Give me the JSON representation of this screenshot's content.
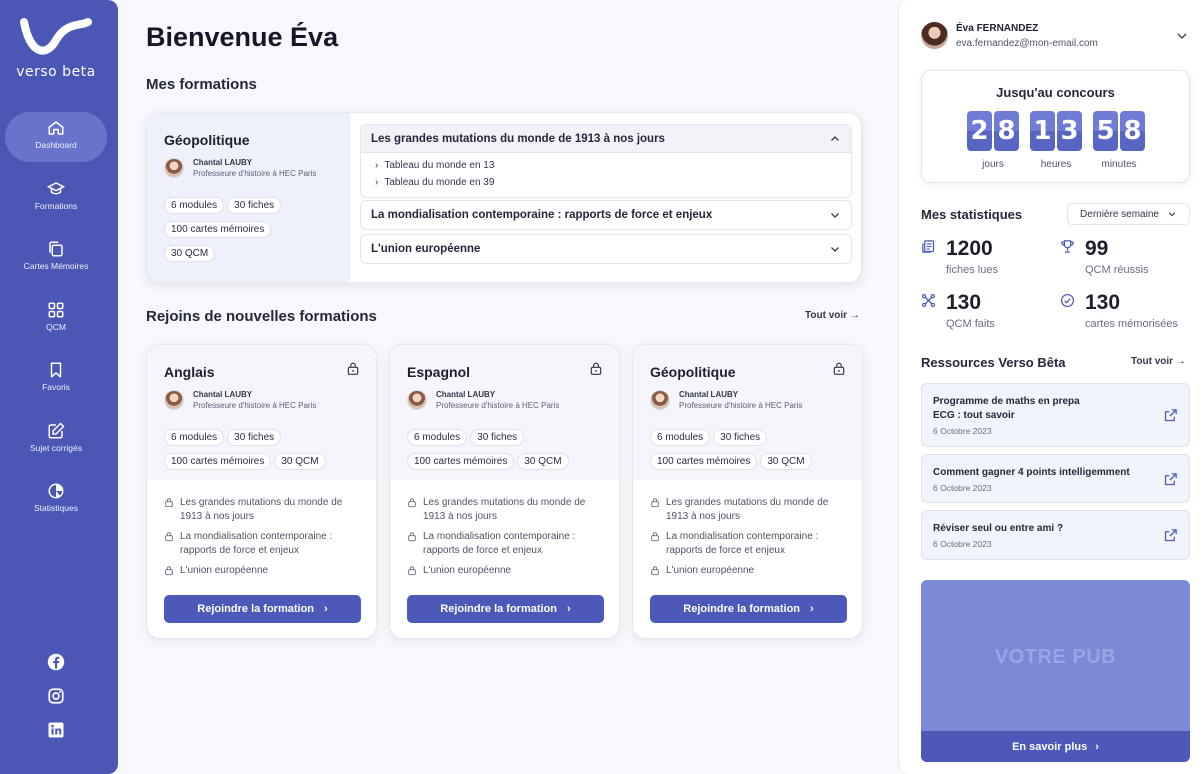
{
  "brand": {
    "logo_text": "verso beta"
  },
  "nav": {
    "items": [
      {
        "label": "Dashboard",
        "icon": "home-icon",
        "active": true
      },
      {
        "label": "Formations",
        "icon": "graduation-cap-icon"
      },
      {
        "label": "Cartes Mémoires",
        "icon": "cards-icon"
      },
      {
        "label": "QCM",
        "icon": "grid-icon"
      },
      {
        "label": "Favoris",
        "icon": "bookmark-icon"
      },
      {
        "label": "Sujet corrigés",
        "icon": "edit-icon"
      },
      {
        "label": "Statistiques",
        "icon": "pie-chart-icon"
      }
    ],
    "social": [
      "facebook-icon",
      "instagram-icon",
      "linkedin-icon"
    ]
  },
  "main": {
    "welcome": "Bienvenue Éva",
    "my_formations_title": "Mes formations",
    "current": {
      "title": "Géopolitique",
      "teacher_name": "Chantal LAUBY",
      "teacher_role": "Professeure d'histoire à HEC Paris",
      "pills": [
        "6 modules",
        "30 fiches",
        "100 cartes mémoires",
        "30 QCM"
      ],
      "modules": [
        {
          "title": "Les grandes mutations du monde de 1913 à nos jours",
          "open": true,
          "items": [
            "Tableau du monde en 13",
            "Tableau du monde en 39"
          ]
        },
        {
          "title": "La mondialisation contemporaine : rapports de force et enjeux",
          "open": false
        },
        {
          "title": "L'union européenne",
          "open": false
        }
      ]
    },
    "new_formations_title": "Rejoins de nouvelles formations",
    "see_all": "Tout voir",
    "cards": [
      {
        "title": "Anglais"
      },
      {
        "title": "Espagnol"
      },
      {
        "title": "Géopolitique"
      }
    ],
    "card_common": {
      "teacher_name": "Chantal LAUBY",
      "teacher_role": "Professeure d'histoire à HEC Paris",
      "pills": [
        "6 modules",
        "30 fiches",
        "100 cartes mémoires",
        "30 QCM"
      ],
      "chapters": [
        "Les grandes mutations du monde de 1913 à nos jours",
        "La mondialisation contemporaine : rapports de force et enjeux",
        "L'union européenne"
      ],
      "join_label": "Rejoindre la formation"
    }
  },
  "user": {
    "name": "Éva FERNANDEZ",
    "email": "eva.fernandez@mon-email.com"
  },
  "countdown": {
    "title": "Jusqu'au concours",
    "groups": [
      {
        "digits": [
          "2",
          "8"
        ],
        "label": "jours"
      },
      {
        "digits": [
          "1",
          "3"
        ],
        "label": "heures"
      },
      {
        "digits": [
          "5",
          "8"
        ],
        "label": "minutes"
      }
    ]
  },
  "stats": {
    "title": "Mes statistiques",
    "period": "Dernière semaine",
    "items": [
      {
        "value": "1200",
        "label": "fiches lues",
        "icon": "document-icon"
      },
      {
        "value": "99",
        "label": "QCM réussis",
        "icon": "trophy-icon"
      },
      {
        "value": "130",
        "label": "QCM faits",
        "icon": "flow-icon"
      },
      {
        "value": "130",
        "label": "cartes mémorisées",
        "icon": "check-circle-icon"
      }
    ]
  },
  "resources": {
    "title": "Ressources Verso Bêta",
    "see_all": "Tout voir",
    "items": [
      {
        "title": "Programme de maths en prepa ECG : tout savoir",
        "date": "6 Octobre 2023"
      },
      {
        "title": "Comment gagner 4 points intelligemment",
        "date": "6 Octobre 2023"
      },
      {
        "title": "Réviser seul ou entre ami ?",
        "date": "6 Octobre 2023"
      }
    ]
  },
  "ad": {
    "text": "VOTRE PUB",
    "button": "En savoir plus"
  },
  "colors": {
    "primary": "#4a57b5",
    "accent": "#4c59b9",
    "nav_active": "#6874cc"
  }
}
